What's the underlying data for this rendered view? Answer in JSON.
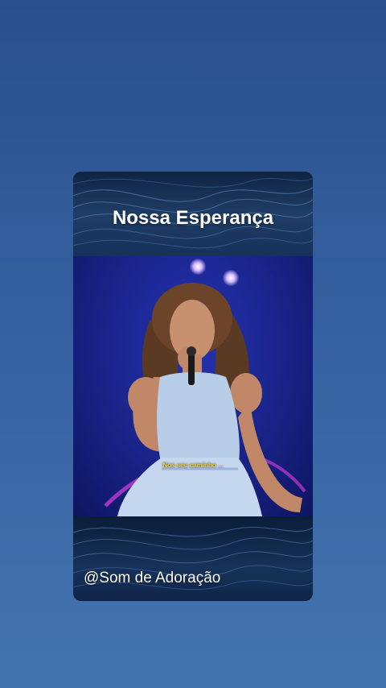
{
  "post": {
    "title": "Nossa Esperança",
    "handle": "@Som de Adoração",
    "video_caption": "Nos seu caminho ..."
  },
  "colors": {
    "background_top": "#2a4f8c",
    "background_bottom": "#4474b0",
    "card_header": "#1f3d66",
    "stage_blue": "#1b2690",
    "caption_yellow": "#f2d640",
    "dress": "#b7cde8"
  }
}
